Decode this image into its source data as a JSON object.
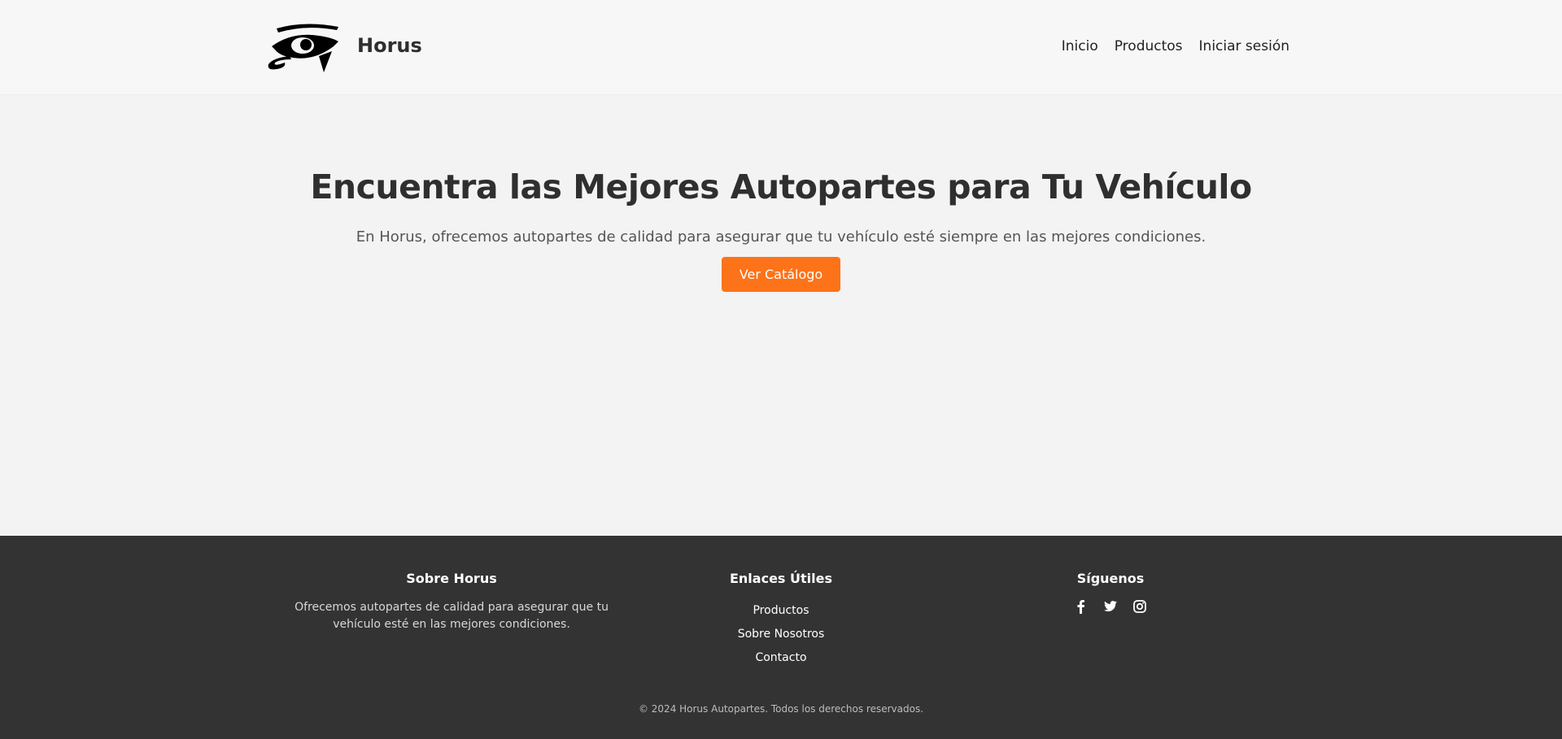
{
  "header": {
    "brand": "Horus",
    "nav": [
      {
        "label": "Inicio"
      },
      {
        "label": "Productos"
      },
      {
        "label": "Iniciar sesión"
      }
    ]
  },
  "hero": {
    "title": "Encuentra las Mejores Autopartes para Tu Vehículo",
    "subtitle": "En Horus, ofrecemos autopartes de calidad para asegurar que tu vehículo esté siempre en las mejores condiciones.",
    "button_label": "Ver Catálogo"
  },
  "footer": {
    "about": {
      "title": "Sobre Horus",
      "text": "Ofrecemos autopartes de calidad para asegurar que tu vehículo esté en las mejores condiciones."
    },
    "links": {
      "title": "Enlaces Útiles",
      "items": [
        {
          "label": "Productos"
        },
        {
          "label": "Sobre Nosotros"
        },
        {
          "label": "Contacto"
        }
      ]
    },
    "social": {
      "title": "Síguenos",
      "icons": [
        "facebook-icon",
        "twitter-icon",
        "instagram-icon"
      ]
    },
    "copyright": "© 2024 Horus Autopartes. Todos los derechos reservados."
  },
  "colors": {
    "accent": "#fd7319",
    "footer_bg": "#333333",
    "header_bg": "#f7f7f7",
    "page_bg": "#f3f3f3"
  }
}
